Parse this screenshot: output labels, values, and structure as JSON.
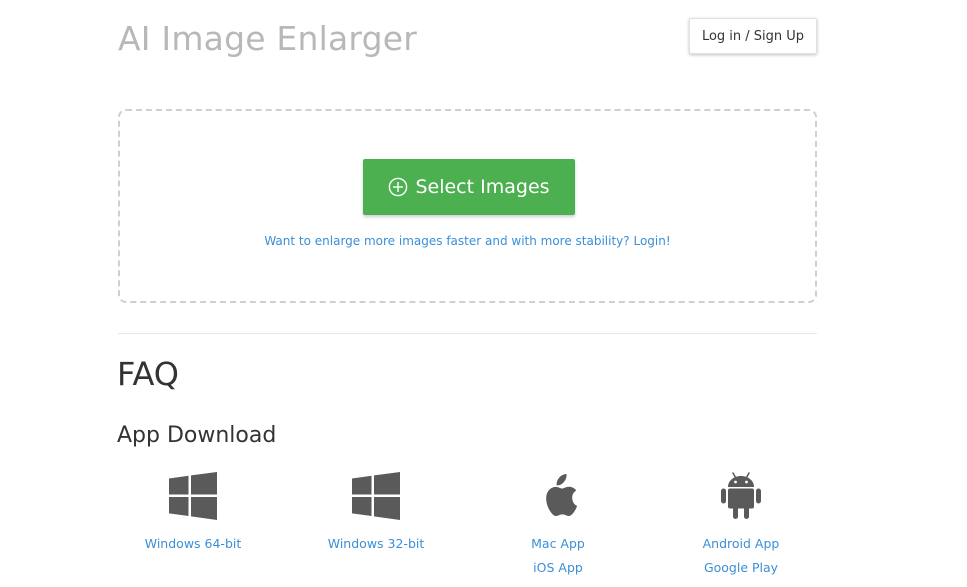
{
  "header": {
    "title": "AI Image Enlarger",
    "login_label": "Log in / Sign Up"
  },
  "upload": {
    "select_label": "Select Images",
    "hint": "Want to enlarge more images faster and with more stability? Login!"
  },
  "faq": {
    "heading": "FAQ"
  },
  "downloads": {
    "heading": "App Download",
    "items": [
      {
        "icon": "windows-icon",
        "links": [
          "Windows 64-bit"
        ]
      },
      {
        "icon": "windows-icon",
        "links": [
          "Windows 32-bit"
        ]
      },
      {
        "icon": "apple-icon",
        "links": [
          "Mac App",
          "iOS App"
        ]
      },
      {
        "icon": "android-icon",
        "links": [
          "Android App",
          "Google Play"
        ]
      }
    ]
  },
  "colors": {
    "accent_green": "#4caf50",
    "link_blue": "#3a8fd8",
    "title_gray": "#b8b8b8",
    "icon_gray": "#5a5a5a"
  }
}
